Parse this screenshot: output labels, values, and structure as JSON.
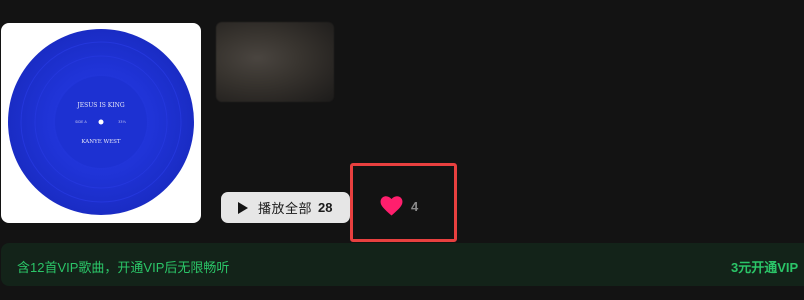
{
  "album": {
    "cover_title": "JESUS IS KING",
    "cover_artist": "KANYE WEST",
    "cover_left_text": "SIDE A",
    "cover_right_text": "33⅓",
    "cover_color": "#1f33d6"
  },
  "actions": {
    "play_all_label": "播放全部",
    "play_all_count": "28",
    "like_count": "4",
    "like_color": "#ff1f6d"
  },
  "vip": {
    "message": "含12首VIP歌曲，开通VIP后无限畅听",
    "cta": "3元开通VIP"
  }
}
